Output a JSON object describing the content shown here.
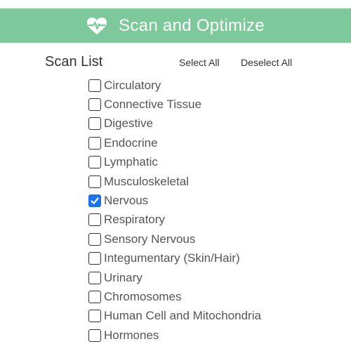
{
  "header": {
    "title": "Scan and Optimize",
    "icon": "heart-pulse-icon",
    "background": "#7dc99b"
  },
  "scan_list": {
    "title": "Scan List",
    "select_all_label": "Select All",
    "deselect_all_label": "Deselect All",
    "accent_color": "#1a73e8",
    "items": [
      {
        "label": "Circulatory",
        "checked": false
      },
      {
        "label": "Connective Tissue",
        "checked": false
      },
      {
        "label": "Digestive",
        "checked": false
      },
      {
        "label": "Endocrine",
        "checked": false
      },
      {
        "label": "Lymphatic",
        "checked": false
      },
      {
        "label": "Musculoskeletal",
        "checked": false
      },
      {
        "label": "Nervous",
        "checked": true
      },
      {
        "label": "Respiratory",
        "checked": false
      },
      {
        "label": "Sensory Nervous",
        "checked": false
      },
      {
        "label": "Integumentary (Skin/Hair)",
        "checked": false
      },
      {
        "label": "Urinary",
        "checked": false
      },
      {
        "label": "Chromosomes",
        "checked": false
      },
      {
        "label": "Human Cell and Mitochondria",
        "checked": false
      },
      {
        "label": "Hormones",
        "checked": false
      }
    ]
  }
}
